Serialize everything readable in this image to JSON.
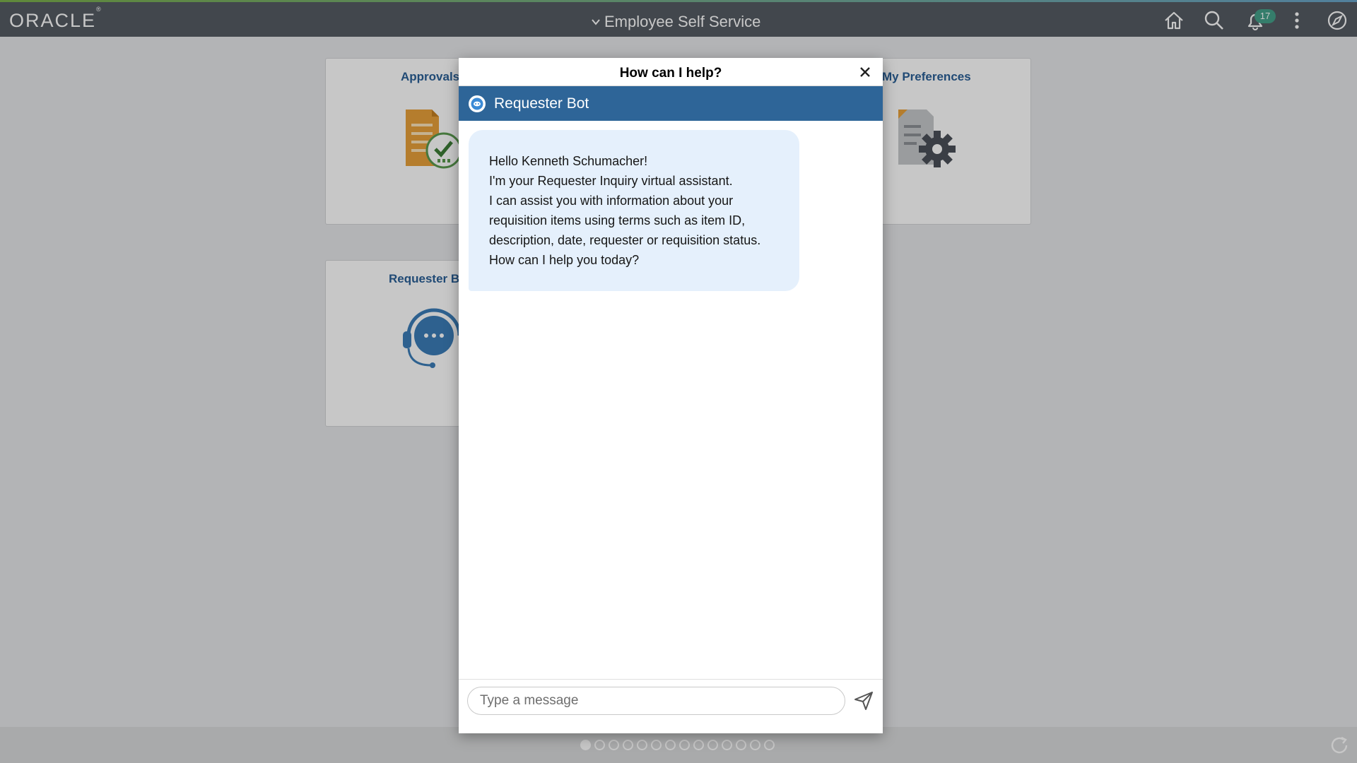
{
  "header": {
    "brand": "ORACLE",
    "brand_mark": "®",
    "title": "Employee Self Service",
    "notification_count": "17",
    "icons": [
      "home-icon",
      "search-icon",
      "bell-icon",
      "more-vertical-icon",
      "compass-icon"
    ]
  },
  "tiles": [
    {
      "title": "Approvals",
      "icon": "approvals-document-check-icon"
    },
    {
      "title": "My Preferences",
      "icon": "preferences-document-gear-icon"
    },
    {
      "title": "Requester B",
      "icon": "headset-chat-icon"
    }
  ],
  "modal": {
    "title": "How can I help?",
    "close_label": "×",
    "bot_name": "Requester Bot",
    "message_lines": [
      "Hello  Kenneth Schumacher!",
      "I'm your Requester Inquiry virtual assistant.",
      "I can assist you with information about your",
      "requisition items using terms such as item ID,",
      "description, date, requester or requisition status.",
      "How can I help you today?"
    ],
    "input_placeholder": "Type a message",
    "input_value": ""
  },
  "pager": {
    "page_count": 14,
    "active_page": 1
  },
  "colors": {
    "header_bg": "#555b63",
    "bot_bar": "#2e6598",
    "bubble": "#e5f0fc",
    "tile_title": "#2a5f96",
    "badge": "#44a08a"
  }
}
